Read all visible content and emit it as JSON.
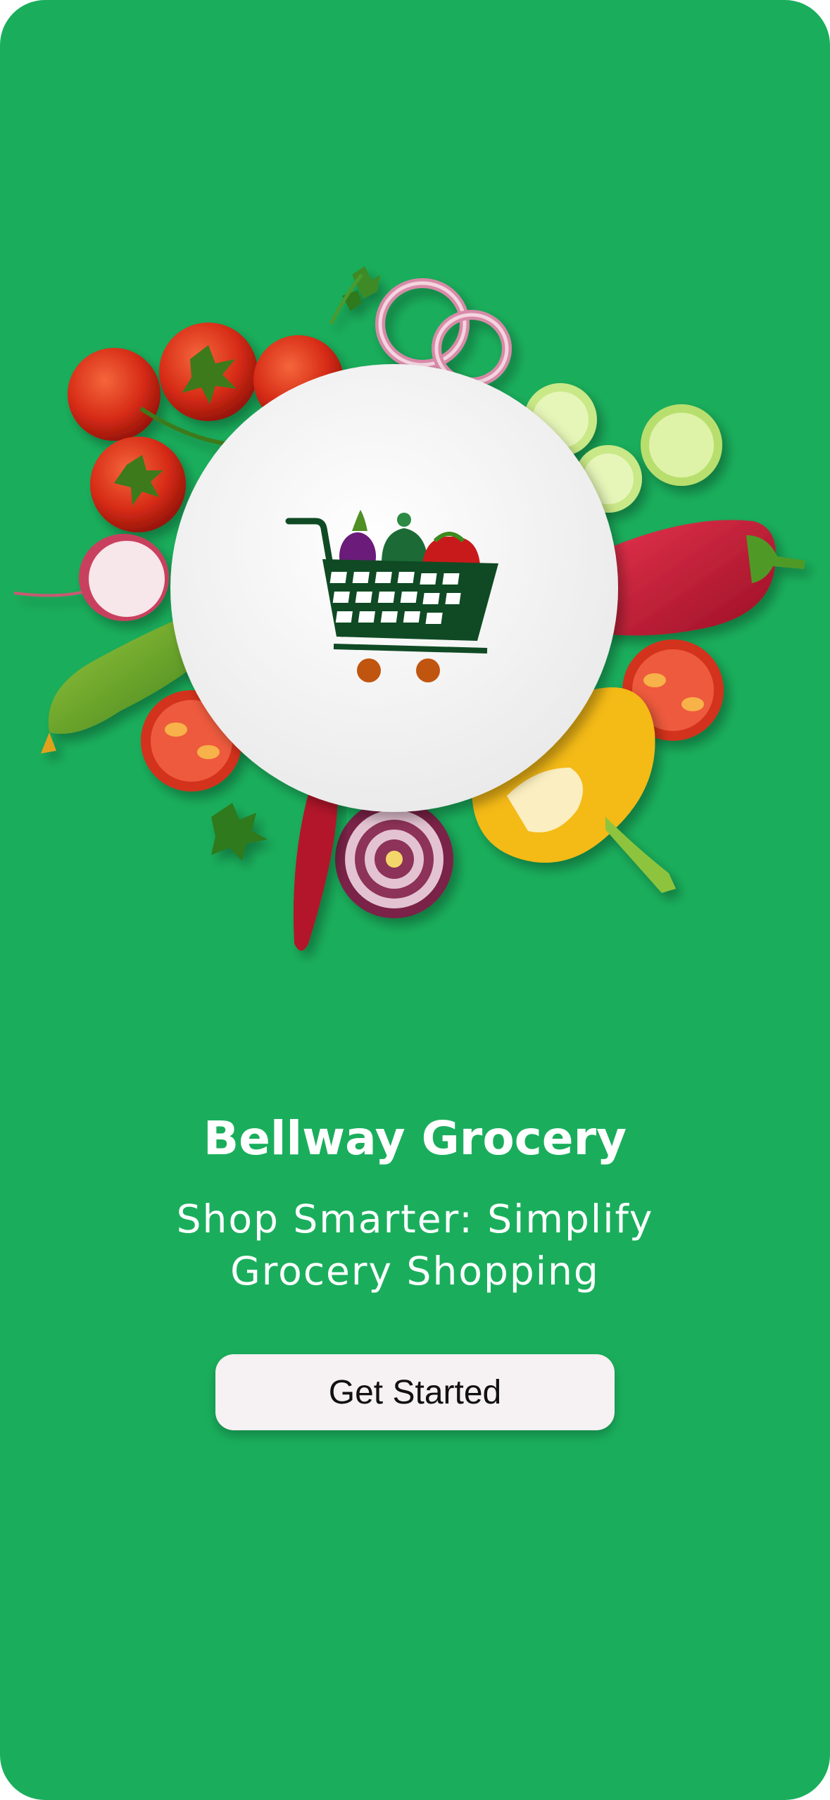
{
  "app": {
    "name": "Bellway Grocery",
    "tagline_line1": "Shop Smarter: Simplify",
    "tagline_line2": "Grocery Shopping"
  },
  "cta": {
    "label": "Get Started"
  },
  "hero": {
    "image": "vegetables-around-plate",
    "logo_icon": "shopping-cart-with-vegetables-icon"
  },
  "colors": {
    "background": "#1aae5c",
    "button_bg": "#f6f1f2",
    "cart": "#0f4a24",
    "cart_wheels": "#c0550f"
  }
}
